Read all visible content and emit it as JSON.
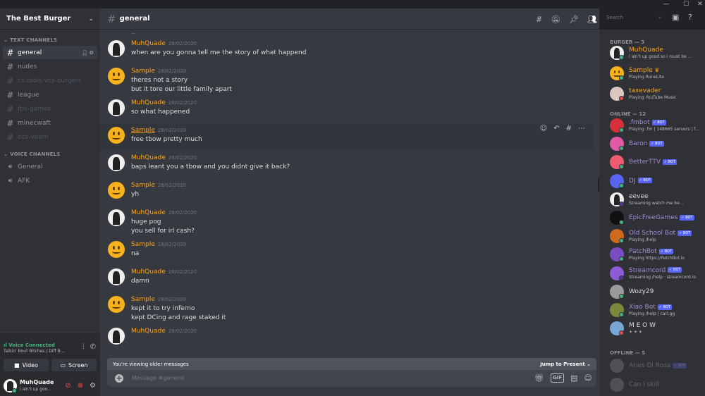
{
  "server": {
    "name": "The Best Burger"
  },
  "categories": {
    "text": "TEXT CHANNELS",
    "voice": "VOICE CHANNELS"
  },
  "text_channels": [
    {
      "name": "general",
      "state": "active"
    },
    {
      "name": "nudes",
      "state": "normal"
    },
    {
      "name": "cs-tools-vcs-burgers",
      "state": "muted"
    },
    {
      "name": "league",
      "state": "normal"
    },
    {
      "name": "fps-games",
      "state": "muted"
    },
    {
      "name": "minecwaft",
      "state": "normal"
    },
    {
      "name": "bcs-voam",
      "state": "muted"
    }
  ],
  "voice_channels": [
    {
      "name": "General"
    },
    {
      "name": "AFK"
    }
  ],
  "voice_panel": {
    "status": "Voice Connected",
    "channel": "Talkin' Bout Bitches / Diff B...",
    "video_label": "Video",
    "screen_label": "Screen"
  },
  "user": {
    "name": "MuhQuade",
    "status": "i ain't up goo..."
  },
  "channel_header": {
    "name": "general",
    "search_placeholder": "Search"
  },
  "messages": [
    {
      "author": "MuhQuade",
      "time": "28/02/2020",
      "color": "#faa61a",
      "avatar": "dark",
      "lines": [
        "when are you gonna tell me the story of what happend"
      ]
    },
    {
      "author": "Sample",
      "time": "28/02/2020",
      "color": "#faa61a",
      "avatar": "smiley",
      "lines": [
        "theres not a story",
        "but it tore our little family apart"
      ]
    },
    {
      "author": "MuhQuade",
      "time": "28/02/2020",
      "color": "#faa61a",
      "avatar": "dark",
      "lines": [
        "so what happened"
      ]
    },
    {
      "author": "Sample",
      "time": "28/02/2020",
      "color": "#faa61a",
      "avatar": "smiley",
      "lines": [
        "free tbow pretty much"
      ],
      "hover": true
    },
    {
      "author": "MuhQuade",
      "time": "28/02/2020",
      "color": "#faa61a",
      "avatar": "dark",
      "lines": [
        "baps leant you a tbow and you didnt give it back?"
      ]
    },
    {
      "author": "Sample",
      "time": "28/02/2020",
      "color": "#faa61a",
      "avatar": "smiley",
      "lines": [
        "yh"
      ]
    },
    {
      "author": "MuhQuade",
      "time": "28/02/2020",
      "color": "#faa61a",
      "avatar": "dark",
      "lines": [
        "huge pog",
        "you sell for irl cash?"
      ]
    },
    {
      "author": "Sample",
      "time": "28/02/2020",
      "color": "#faa61a",
      "avatar": "smiley",
      "lines": [
        "na"
      ]
    },
    {
      "author": "MuhQuade",
      "time": "28/02/2020",
      "color": "#faa61a",
      "avatar": "dark",
      "lines": [
        "damn"
      ]
    },
    {
      "author": "Sample",
      "time": "28/02/2020",
      "color": "#faa61a",
      "avatar": "smiley",
      "lines": [
        "kept it to try inferno",
        "kept DCing and rage staked it"
      ]
    },
    {
      "author": "MuhQuade",
      "time": "28/02/2020",
      "color": "#faa61a",
      "avatar": "dark",
      "lines": []
    }
  ],
  "older_bar": {
    "text": "You're viewing older messages",
    "jump": "Jump to Present"
  },
  "input": {
    "placeholder": "Message #general"
  },
  "member_categories": {
    "burger": "BURGER — 3",
    "online": "ONLINE — 12",
    "offline": "OFFLINE — 5"
  },
  "members_burger": [
    {
      "name": "MuhQuade",
      "sub": "i ain't up good so i must be ...",
      "color": "#faa61a",
      "status": "#43b581",
      "avatar": "dark"
    },
    {
      "name": "Sample",
      "sub": "Playing RuneLite",
      "color": "#faa61a",
      "status": "#43b581",
      "avatar": "smiley",
      "crown": "♛"
    },
    {
      "name": "taxevader",
      "sub": "Playing YouTube Music",
      "color": "#faa61a",
      "status": "#f04747",
      "avatar": "pale"
    }
  ],
  "members_online": [
    {
      "name": ".fmbot",
      "sub": "Playing .fm | 148665 servers | f...",
      "color": "#a48bd2",
      "status": "#43b581",
      "avatar": "red",
      "bot": "BOT"
    },
    {
      "name": "Baron",
      "sub": "",
      "color": "#a48bd2",
      "status": "#43b581",
      "avatar": "pink",
      "bot": "BOT"
    },
    {
      "name": "BetterTTV",
      "sub": "",
      "color": "#a48bd2",
      "status": "#43b581",
      "avatar": "rose",
      "bot": "BOT"
    },
    {
      "name": "DJ",
      "sub": "",
      "color": "#a48bd2",
      "status": "#43b581",
      "avatar": "blue",
      "bot": "BOT"
    },
    {
      "name": "eevee",
      "sub": "Streaming watch me be...",
      "color": "#dcddde",
      "status": "#593695",
      "avatar": "dark"
    },
    {
      "name": "EpicFreeGames",
      "sub": "",
      "color": "#a48bd2",
      "status": "#43b581",
      "avatar": "black",
      "bot": "BOT"
    },
    {
      "name": "Old School Bot",
      "sub": "Playing /help",
      "color": "#a48bd2",
      "status": "#43b581",
      "avatar": "orange",
      "bot": "BOT"
    },
    {
      "name": "PatchBot",
      "sub": "Playing https://PatchBot.io",
      "color": "#a48bd2",
      "status": "#43b581",
      "avatar": "purple",
      "bot": "BOT"
    },
    {
      "name": "Streamcord",
      "sub": "Streaming /help · streamcord.io",
      "color": "#a48bd2",
      "status": "#593695",
      "avatar": "violet",
      "bot": "BOT"
    },
    {
      "name": "Wozy29",
      "sub": "",
      "color": "#dcddde",
      "status": "#43b581",
      "avatar": "grey"
    },
    {
      "name": "Xiao Bot",
      "sub": "Playing /help | carl.gg",
      "color": "#a48bd2",
      "status": "#43b581",
      "avatar": "olive",
      "bot": "BOT"
    },
    {
      "name": "M E O W",
      "sub": "✦ ✦ ✦",
      "color": "#dcddde",
      "status": "#f04747",
      "avatar": "sky"
    }
  ],
  "members_offline": [
    {
      "name": "Aries Di Rosa",
      "sub": "",
      "color": "#dcddde",
      "avatar": "grey",
      "bot": "BOT"
    },
    {
      "name": "Can i skill",
      "sub": "",
      "color": "#dcddde",
      "avatar": "grey"
    }
  ]
}
